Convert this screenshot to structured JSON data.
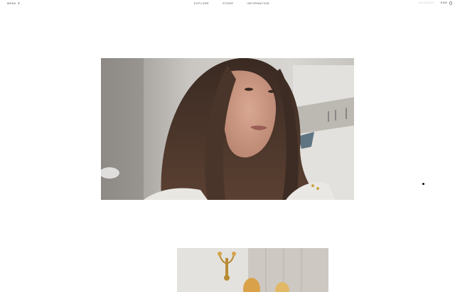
{
  "header": {
    "menu_label": "MENU",
    "nav": [
      {
        "label": "EXPLORE"
      },
      {
        "label": "STORE"
      },
      {
        "label": "INFORMATION"
      }
    ],
    "account_label": "ACCOUNT",
    "language_label": "ENG"
  },
  "gallery": {
    "images": [
      {
        "icon": "portrait-photo",
        "description_visible": false
      },
      {
        "icon": "interior-photo",
        "description_visible": false
      }
    ]
  },
  "colors": {
    "background": "#ffffff",
    "nav_text": "#444444",
    "account_text": "#bdbdbd"
  }
}
